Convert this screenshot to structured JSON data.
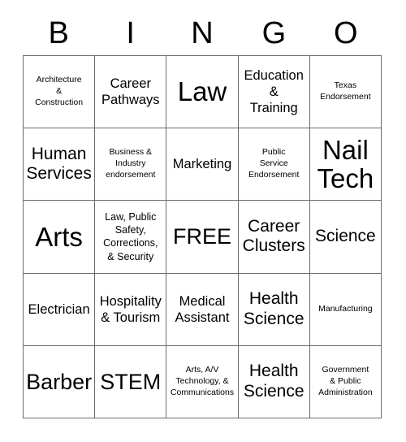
{
  "card": {
    "title": "BINGO",
    "header_letters": [
      "B",
      "I",
      "N",
      "G",
      "O"
    ],
    "grid_size": "5x5",
    "free_space": "FREE",
    "colors": {
      "text": "#000000",
      "grid_line": "#6b6b6b",
      "background": "#ffffff"
    },
    "rows": [
      [
        {
          "text": "Architecture\n&\nConstruction",
          "size": "xs"
        },
        {
          "text": "Career\nPathways",
          "size": "m"
        },
        {
          "text": "Law",
          "size": "xxl"
        },
        {
          "text": "Education\n&\nTraining",
          "size": "m"
        },
        {
          "text": "Texas\nEndorsement",
          "size": "xs"
        }
      ],
      [
        {
          "text": "Human\nServices",
          "size": "l"
        },
        {
          "text": "Business &\nIndustry\nendorsement",
          "size": "xs"
        },
        {
          "text": "Marketing",
          "size": "m"
        },
        {
          "text": "Public\nService\nEndorsement",
          "size": "xs"
        },
        {
          "text": "Nail\nTech",
          "size": "xxl"
        }
      ],
      [
        {
          "text": "Arts",
          "size": "xxl"
        },
        {
          "text": "Law, Public\nSafety,\nCorrections,\n& Security",
          "size": "s"
        },
        {
          "text": "FREE",
          "size": "xl"
        },
        {
          "text": "Career\nClusters",
          "size": "l"
        },
        {
          "text": "Science",
          "size": "l"
        }
      ],
      [
        {
          "text": "Electrician",
          "size": "m"
        },
        {
          "text": "Hospitality\n& Tourism",
          "size": "m"
        },
        {
          "text": "Medical\nAssistant",
          "size": "m"
        },
        {
          "text": "Health\nScience",
          "size": "l"
        },
        {
          "text": "Manufacturing",
          "size": "xs"
        }
      ],
      [
        {
          "text": "Barber",
          "size": "xl"
        },
        {
          "text": "STEM",
          "size": "xl"
        },
        {
          "text": "Arts, A/V\nTechnology, &\nCommunications",
          "size": "xs"
        },
        {
          "text": "Health\nScience",
          "size": "l"
        },
        {
          "text": "Government\n& Public\nAdministration",
          "size": "xs"
        }
      ]
    ]
  }
}
